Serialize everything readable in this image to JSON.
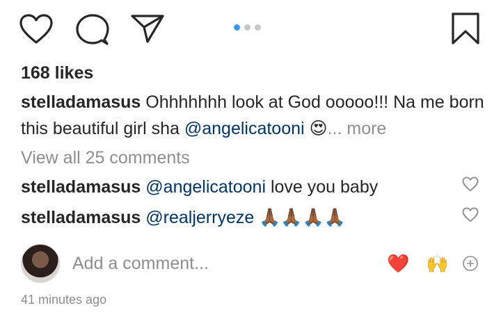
{
  "actions": {
    "like_icon": "heart-outline-icon",
    "comment_icon": "speech-bubble-icon",
    "share_icon": "paper-plane-icon",
    "save_icon": "bookmark-icon",
    "carousel": {
      "count": 3,
      "active_index": 0,
      "active_color": "#3897f0",
      "inactive_color": "#c7c7c7"
    }
  },
  "post": {
    "likes": "168 likes",
    "caption": {
      "username": "stelladamasus",
      "text": " Ohhhhhhh look at God ooooo!!! Na me born this beautiful girl sha ",
      "mention": "@angelicatooni",
      "emoji": "😍",
      "more": "... more"
    },
    "view_all_comments": "View all 25 comments",
    "comments": [
      {
        "username": "stelladamasus",
        "mention": "@angelicatooni",
        "text": " love you baby",
        "emoji": ""
      },
      {
        "username": "stelladamasus",
        "mention": "@realjerryeze",
        "text": " ",
        "emoji": "🙏🏾🙏🏾🙏🏾🙏🏾"
      }
    ],
    "add_comment": {
      "placeholder": "Add a comment...",
      "quick_reactions": [
        "❤️",
        "🙌"
      ],
      "add_icon": "plus-circle-icon"
    },
    "timestamp": "41 minutes ago"
  },
  "colors": {
    "text": "#262626",
    "muted": "#8e8e8e",
    "mention": "#003569",
    "heart_red": "#ed2e4a"
  }
}
